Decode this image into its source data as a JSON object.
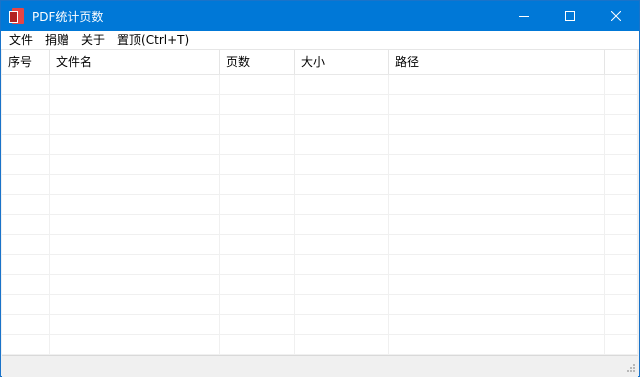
{
  "window": {
    "title": "PDF统计页数"
  },
  "menu": {
    "items": [
      {
        "label": "文件"
      },
      {
        "label": "捐赠"
      },
      {
        "label": "关于"
      },
      {
        "label": "置顶(Ctrl+T)"
      }
    ]
  },
  "table": {
    "columns": [
      "序号",
      "文件名",
      "页数",
      "大小",
      "路径",
      ""
    ],
    "rows": []
  },
  "colors": {
    "titlebar": "#0078d7",
    "grid": "#ffffff",
    "statusbar": "#f0f0f0"
  },
  "icons": [
    "pdf-app-icon",
    "minimize-icon",
    "maximize-icon",
    "close-icon",
    "size-grip-icon"
  ]
}
